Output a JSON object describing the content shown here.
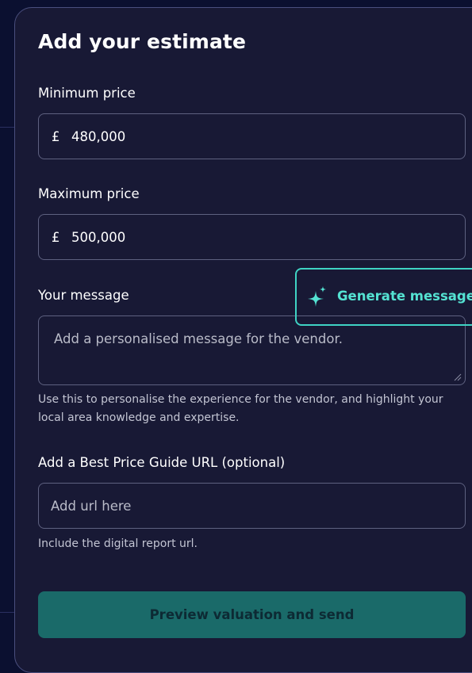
{
  "form": {
    "title": "Add your estimate",
    "min_price": {
      "label": "Minimum price",
      "currency": "£",
      "value": "480,000"
    },
    "max_price": {
      "label": "Maximum price",
      "currency": "£",
      "value": "500,000"
    },
    "message": {
      "label": "Your message",
      "placeholder": "Add a personalised message for the vendor.",
      "generate_label": "Generate message",
      "generate_icon": "sparkle-icon",
      "help": "Use this to personalise the experience for the vendor, and highlight your local area knowledge and expertise."
    },
    "url": {
      "label": "Add a Best Price Guide URL (optional)",
      "placeholder": "Add url here",
      "help": "Include the digital report url."
    },
    "submit_label": "Preview valuation and send"
  },
  "colors": {
    "background": "#0b1030",
    "panel": "#181935",
    "accent": "#54e2d2",
    "submit": "#1a6a69"
  }
}
